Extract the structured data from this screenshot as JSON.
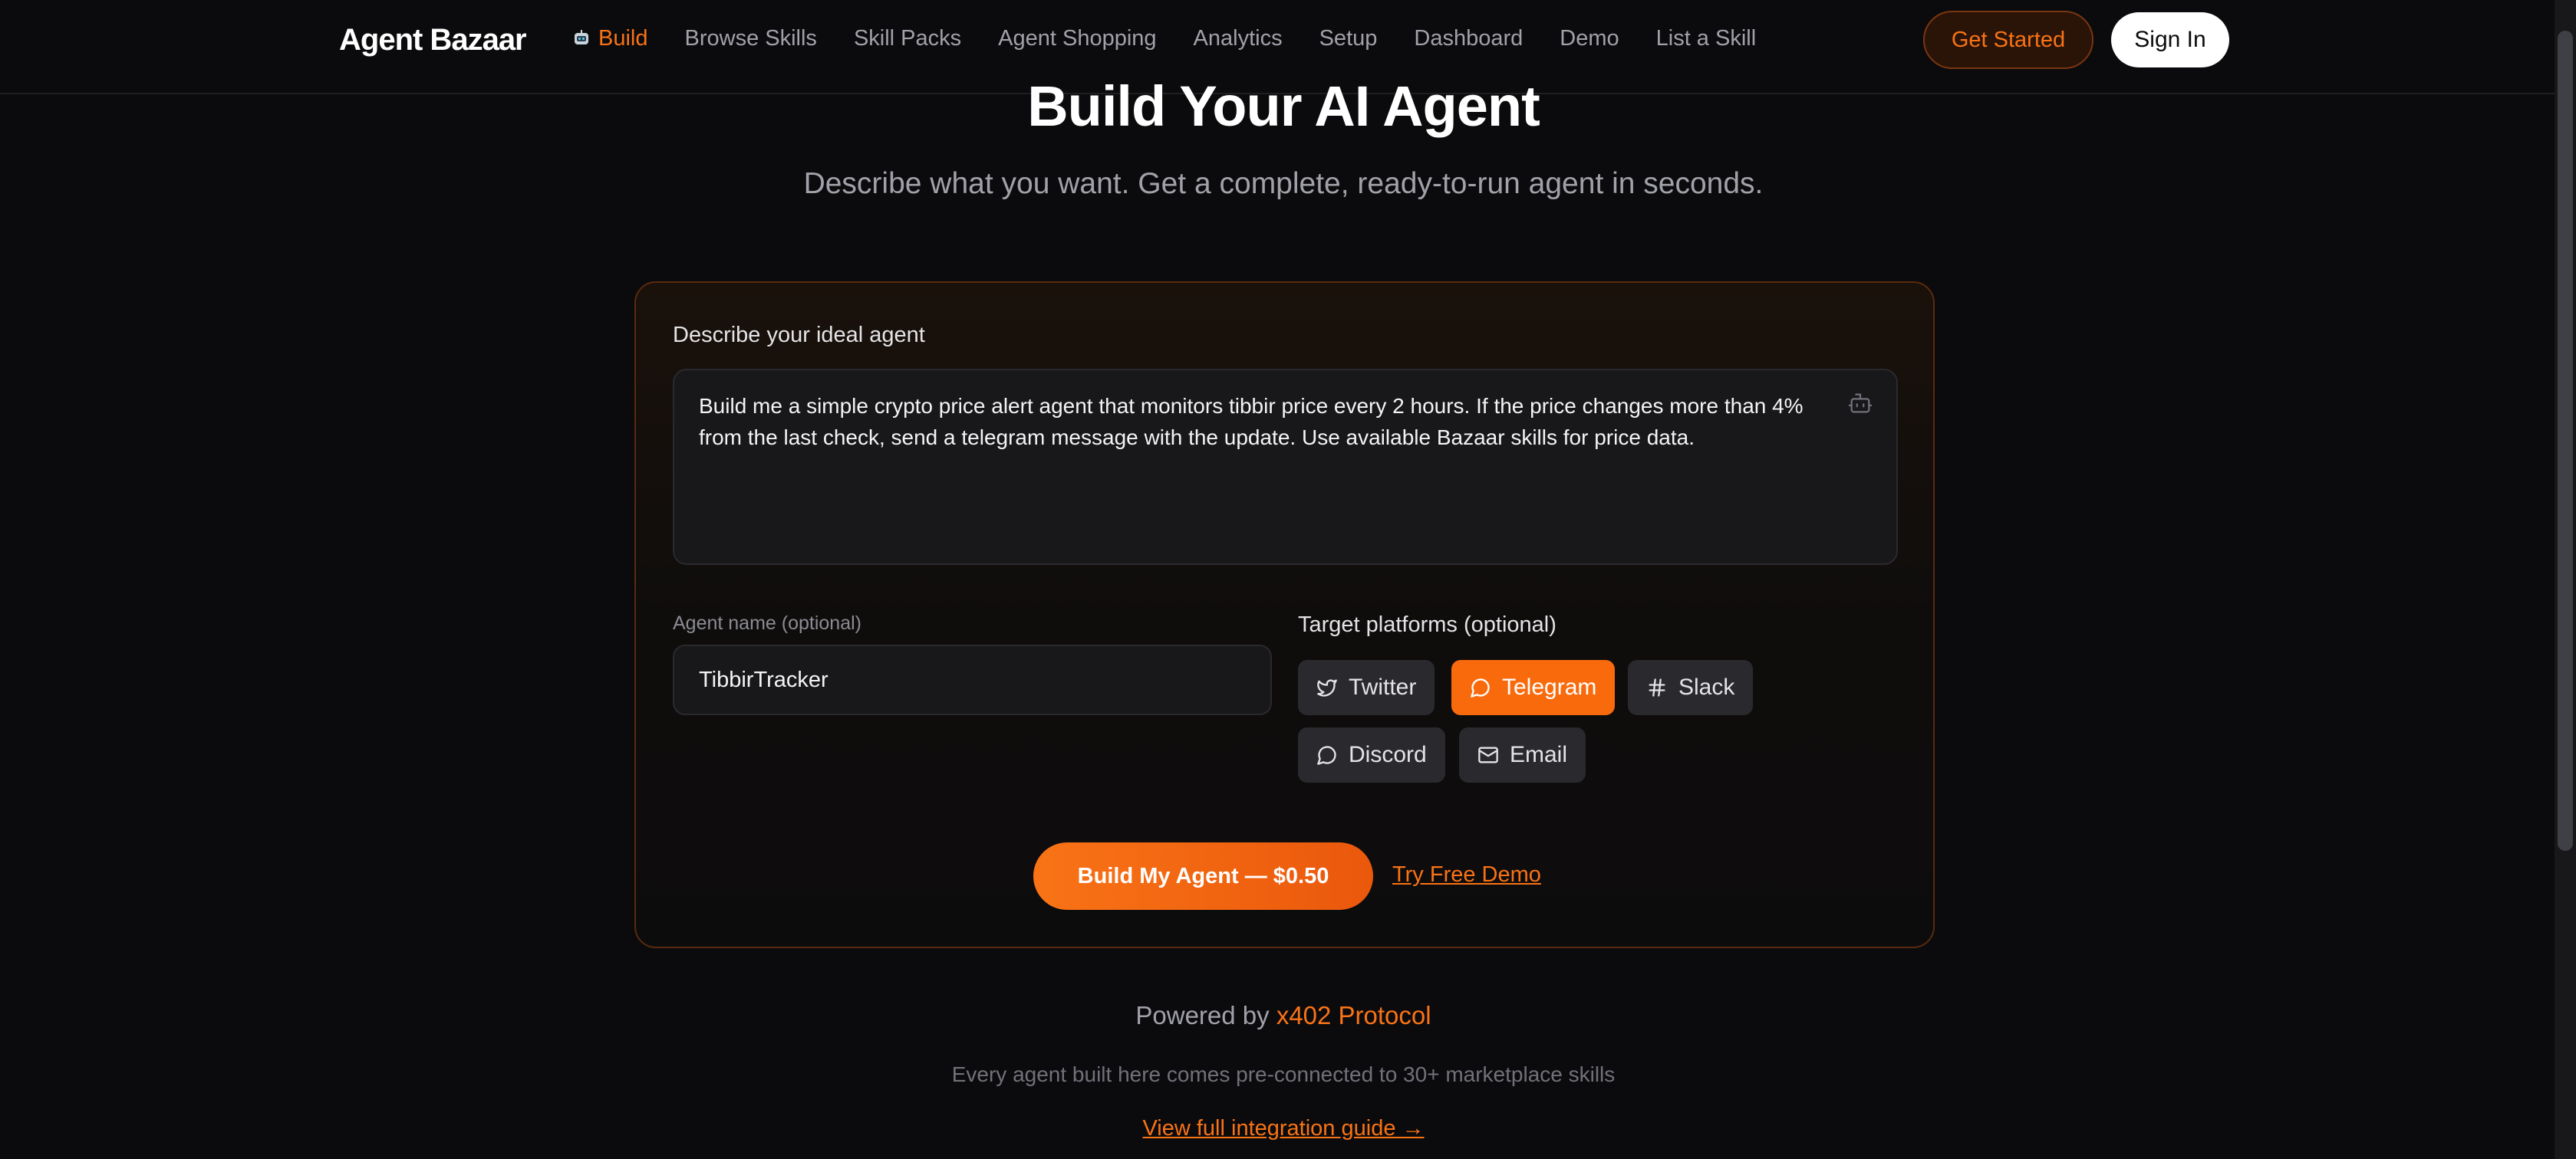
{
  "nav": {
    "logo": "Agent Bazaar",
    "links": [
      "Build",
      "Browse Skills",
      "Skill Packs",
      "Agent Shopping",
      "Analytics",
      "Setup",
      "Dashboard",
      "Demo",
      "List a Skill"
    ],
    "get_started": "Get Started",
    "sign_in": "Sign In"
  },
  "hero": {
    "title": "Build Your AI Agent",
    "subtitle": "Describe what you want. Get a complete, ready-to-run agent in seconds."
  },
  "form": {
    "describe_label": "Describe your ideal agent",
    "description": "Build me a simple crypto price alert agent that monitors tibbir price every 2 hours. If the price changes more than 4% from the last check, send a telegram message with the update. Use available Bazaar skills for price data.",
    "name_label": "Agent name (optional)",
    "name_value": "TibbirTracker",
    "platforms_label": "Target platforms (optional)",
    "platforms": [
      "Twitter",
      "Telegram",
      "Slack",
      "Discord",
      "Email"
    ],
    "selected_platform": "Telegram",
    "build_button": "Build My Agent — $0.50",
    "try_demo": "Try Free Demo"
  },
  "footer": {
    "powered_prefix": "Powered by",
    "powered_link": "x402 Protocol",
    "every": "Every agent built here comes pre-connected to 30+ marketplace skills",
    "guide": "View full integration guide →"
  },
  "colors": {
    "accent": "#f97316",
    "background": "#0b0b0d"
  }
}
